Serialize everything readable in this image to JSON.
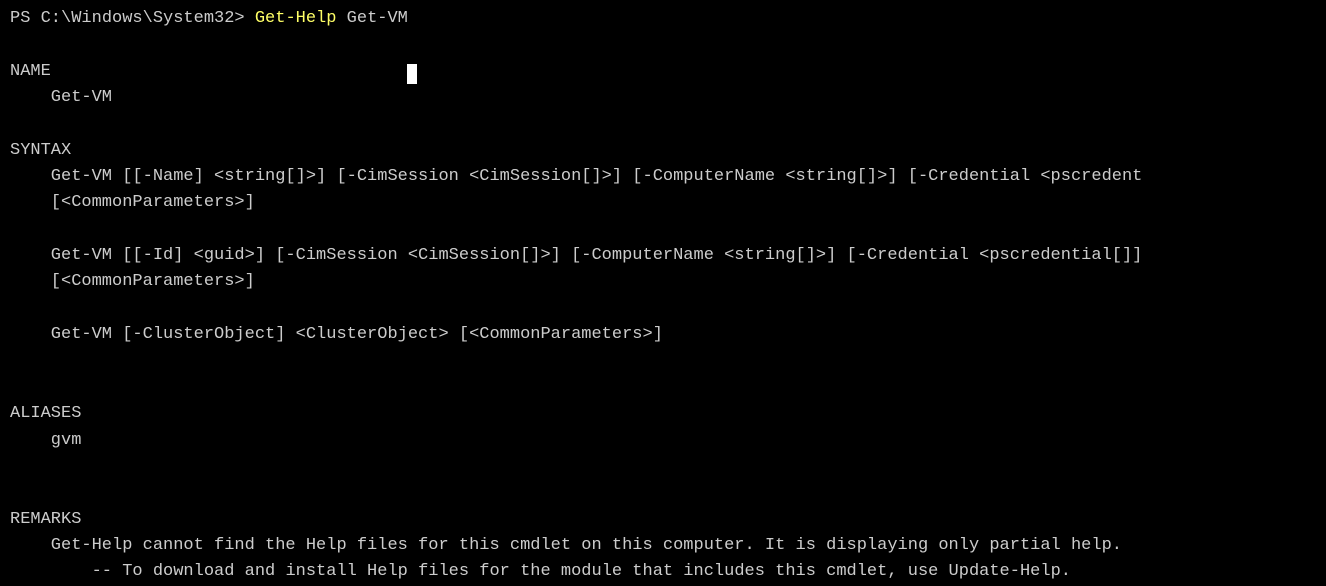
{
  "prompt": {
    "prefix": "PS C:\\Windows\\System32> ",
    "command": "Get-Help",
    "argument": " Get-VM"
  },
  "sections": {
    "name": {
      "header": "NAME",
      "value": "Get-VM"
    },
    "syntax": {
      "header": "SYNTAX",
      "line1": "Get-VM [[-Name] <string[]>] [-CimSession <CimSession[]>] [-ComputerName <string[]>] [-Credential <pscredent",
      "line2": "[<CommonParameters>]",
      "line3": "Get-VM [[-Id] <guid>] [-CimSession <CimSession[]>] [-ComputerName <string[]>] [-Credential <pscredential[]]",
      "line4": "[<CommonParameters>]",
      "line5": "Get-VM [-ClusterObject] <ClusterObject> [<CommonParameters>]"
    },
    "aliases": {
      "header": "ALIASES",
      "value": "gvm"
    },
    "remarks": {
      "header": "REMARKS",
      "line1": "Get-Help cannot find the Help files for this cmdlet on this computer. It is displaying only partial help.",
      "line2": "-- To download and install Help files for the module that includes this cmdlet, use Update-Help."
    }
  }
}
